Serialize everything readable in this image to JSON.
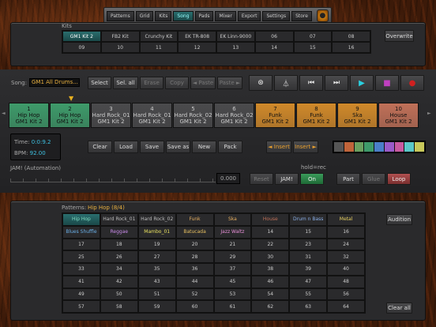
{
  "nav": {
    "tabs": [
      "Patterns",
      "Grid",
      "Kits",
      "Song",
      "Pads",
      "Mixer",
      "Export",
      "Settings",
      "Store"
    ],
    "active": "Song"
  },
  "kits": {
    "label": "Kits",
    "cells": [
      "GM1 Kit 2",
      "FB2 Kit",
      "Crunchy Kit",
      "EK TR-808",
      "EK Linn-9000",
      "06",
      "07",
      "08",
      "09",
      "10",
      "11",
      "12",
      "13",
      "14",
      "15",
      "16"
    ],
    "selected": 0,
    "overwrite": "Overwrite"
  },
  "song": {
    "label": "Song:",
    "name": "GM1 All Drums...",
    "select": "Select",
    "sel_all": "Sel. all",
    "erase": "Erase",
    "copy": "Copy",
    "paste_left": "◄ Paste",
    "paste_right": "Paste ►"
  },
  "patterns_strip": [
    {
      "num": "1",
      "name": "Hip Hop",
      "kit": "GM1 Kit 2",
      "color": "#3e9a6a"
    },
    {
      "num": "2",
      "name": "Hip Hop",
      "kit": "GM1 Kit 2",
      "color": "#3e9a6a"
    },
    {
      "num": "3",
      "name": "Hard Rock_01",
      "kit": "GM1 Kit 2",
      "color": "#4a4a4c"
    },
    {
      "num": "4",
      "name": "Hard Rock_01",
      "kit": "GM1 Kit 2",
      "color": "#4a4a4c"
    },
    {
      "num": "5",
      "name": "Hard Rock_02",
      "kit": "GM1 Kit 2",
      "color": "#4a4a4c"
    },
    {
      "num": "6",
      "name": "Hard Rock_02",
      "kit": "GM1 Kit 2",
      "color": "#4a4a4c"
    },
    {
      "num": "7",
      "name": "Funk",
      "kit": "GM1 Kit 2",
      "color": "#d0892a"
    },
    {
      "num": "8",
      "name": "Funk",
      "kit": "GM1 Kit 2",
      "color": "#d0892a"
    },
    {
      "num": "9",
      "name": "Ska",
      "kit": "GM1 Kit 2",
      "color": "#d0892a"
    },
    {
      "num": "10",
      "name": "House",
      "kit": "GM1 Kit 2",
      "color": "#c07058"
    }
  ],
  "time": {
    "time_label": "Time:",
    "time_value": "0:0:9.2",
    "bpm_label": "BPM:",
    "bpm_value": "92.00"
  },
  "actions": [
    "Clear",
    "Load",
    "Save",
    "Save as",
    "New",
    "Pack"
  ],
  "insert_left": "◄ Insert",
  "insert_right": "Insert ►",
  "palette": [
    "#555",
    "#c0643a",
    "#6aa060",
    "#3e9a6a",
    "#4a7ec8",
    "#9a5ac8",
    "#c85aa0",
    "#5ac8c8",
    "#c8c85a"
  ],
  "automation": {
    "label": "JAM! (Automation)",
    "value": "0.000",
    "reset": "Reset",
    "jam": "JAM!",
    "hold": "hold=rec",
    "on": "On",
    "part": "Part",
    "glue": "Glue",
    "loop": "Loop"
  },
  "patterns": {
    "label": "Patterns:",
    "name": "Hip Hop (8/4)",
    "audition": "Audition",
    "clear_all": "Clear all",
    "cells": [
      {
        "t": "Hip Hop",
        "c": "#7fdcc0"
      },
      {
        "t": "Hard Rock_01",
        "c": "#bbb"
      },
      {
        "t": "Hard Rock_02",
        "c": "#bbb"
      },
      {
        "t": "Funk",
        "c": "#e8b060"
      },
      {
        "t": "Ska",
        "c": "#e8b060"
      },
      {
        "t": "House",
        "c": "#c07058"
      },
      {
        "t": "Drum n Bass",
        "c": "#8ab0e8"
      },
      {
        "t": "Metal",
        "c": "#e8d060"
      },
      {
        "t": "Blues Shuffle",
        "c": "#6ab0e8"
      },
      {
        "t": "Reggae",
        "c": "#c88ae8"
      },
      {
        "t": "Mambo_01",
        "c": "#e8e060"
      },
      {
        "t": "Batucada",
        "c": "#e8c060"
      },
      {
        "t": "Jazz Waltz",
        "c": "#e890d8"
      },
      {
        "t": "14",
        "c": "#ccc"
      },
      {
        "t": "15",
        "c": "#ccc"
      },
      {
        "t": "16",
        "c": "#ccc"
      },
      {
        "t": "17",
        "c": "#ccc"
      },
      {
        "t": "18",
        "c": "#ccc"
      },
      {
        "t": "19",
        "c": "#ccc"
      },
      {
        "t": "20",
        "c": "#ccc"
      },
      {
        "t": "21",
        "c": "#ccc"
      },
      {
        "t": "22",
        "c": "#ccc"
      },
      {
        "t": "23",
        "c": "#ccc"
      },
      {
        "t": "24",
        "c": "#ccc"
      },
      {
        "t": "25",
        "c": "#ccc"
      },
      {
        "t": "26",
        "c": "#ccc"
      },
      {
        "t": "27",
        "c": "#ccc"
      },
      {
        "t": "28",
        "c": "#ccc"
      },
      {
        "t": "29",
        "c": "#ccc"
      },
      {
        "t": "30",
        "c": "#ccc"
      },
      {
        "t": "31",
        "c": "#ccc"
      },
      {
        "t": "32",
        "c": "#ccc"
      },
      {
        "t": "33",
        "c": "#ccc"
      },
      {
        "t": "34",
        "c": "#ccc"
      },
      {
        "t": "35",
        "c": "#ccc"
      },
      {
        "t": "36",
        "c": "#ccc"
      },
      {
        "t": "37",
        "c": "#ccc"
      },
      {
        "t": "38",
        "c": "#ccc"
      },
      {
        "t": "39",
        "c": "#ccc"
      },
      {
        "t": "40",
        "c": "#ccc"
      },
      {
        "t": "41",
        "c": "#ccc"
      },
      {
        "t": "42",
        "c": "#ccc"
      },
      {
        "t": "43",
        "c": "#ccc"
      },
      {
        "t": "44",
        "c": "#ccc"
      },
      {
        "t": "45",
        "c": "#ccc"
      },
      {
        "t": "46",
        "c": "#ccc"
      },
      {
        "t": "47",
        "c": "#ccc"
      },
      {
        "t": "48",
        "c": "#ccc"
      },
      {
        "t": "49",
        "c": "#ccc"
      },
      {
        "t": "50",
        "c": "#ccc"
      },
      {
        "t": "51",
        "c": "#ccc"
      },
      {
        "t": "52",
        "c": "#ccc"
      },
      {
        "t": "53",
        "c": "#ccc"
      },
      {
        "t": "54",
        "c": "#ccc"
      },
      {
        "t": "55",
        "c": "#ccc"
      },
      {
        "t": "56",
        "c": "#ccc"
      },
      {
        "t": "57",
        "c": "#ccc"
      },
      {
        "t": "58",
        "c": "#ccc"
      },
      {
        "t": "59",
        "c": "#ccc"
      },
      {
        "t": "60",
        "c": "#ccc"
      },
      {
        "t": "61",
        "c": "#ccc"
      },
      {
        "t": "62",
        "c": "#ccc"
      },
      {
        "t": "63",
        "c": "#ccc"
      },
      {
        "t": "64",
        "c": "#ccc"
      }
    ]
  }
}
